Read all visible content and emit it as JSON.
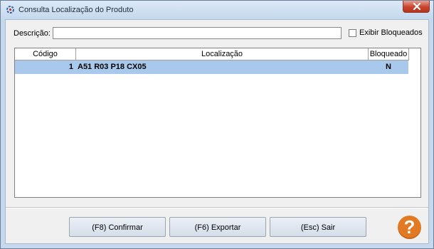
{
  "window": {
    "title": "Consulta Localização do Produto",
    "close_icon": "close-icon"
  },
  "filter": {
    "description_label": "Descrição:",
    "description_value": "",
    "show_blocked_label": "Exibir Bloqueados",
    "show_blocked_checked": false
  },
  "table": {
    "columns": [
      "Código",
      "Localização",
      "Bloqueado"
    ],
    "rows": [
      {
        "codigo": "1",
        "localizacao": "A51 R03 P18 CX05",
        "bloqueado": "N"
      }
    ],
    "selected_row_color": "#a8c8ec"
  },
  "buttons": {
    "confirm_label": "(F8) Confirmar",
    "export_label": "(F6) Exportar",
    "exit_label": "(Esc) Sair",
    "help_glyph": "?"
  },
  "colors": {
    "help_accent": "#e27a24",
    "close_accent": "#c8452e"
  }
}
